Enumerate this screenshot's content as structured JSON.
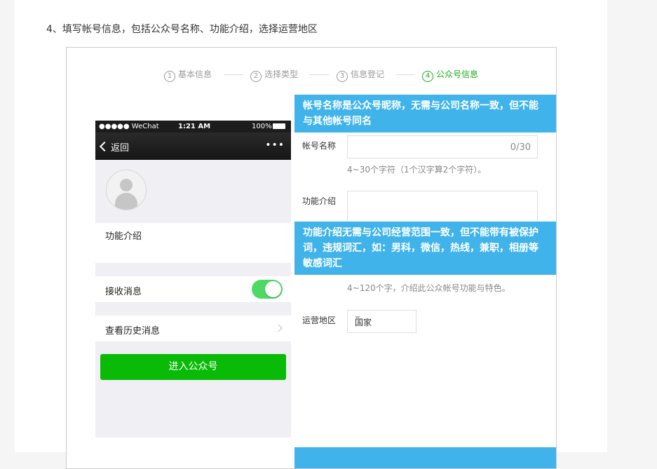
{
  "heading": "4、填写帐号信息，包括公众号名称、功能介绍，选择运营地区",
  "steps": [
    {
      "num": "1",
      "label": "基本信息",
      "active": false
    },
    {
      "num": "2",
      "label": "选择类型",
      "active": false
    },
    {
      "num": "3",
      "label": "信息登记",
      "active": false
    },
    {
      "num": "4",
      "label": "公众号信息",
      "active": true
    }
  ],
  "phone": {
    "carrier": "●●●●● WeChat",
    "time": "1:21 AM",
    "battery": "100%",
    "back_label": "返回",
    "more_label": "•••",
    "intro_label": "功能介绍",
    "receive_label": "接收消息",
    "receive_on": true,
    "history_label": "查看历史消息",
    "enter_label": "进入公众号",
    "colors": {
      "toggle": "#4cd964",
      "enter": "#09bb07"
    }
  },
  "callouts": {
    "name": "帐号名称是公众号昵称，无需与公司名称一致，但不能与其他帐号同名",
    "intro": "功能介绍无需与公司经营范围一致，但不能带有被保护词，违规词汇，如：男科，微信，热线，兼职，相册等敏感词汇",
    "color": "#40b4ea"
  },
  "form": {
    "name_label": "帐号名称",
    "name_counter": "0/30",
    "name_hint": "4~30个字符（1个汉字算2个字符）。",
    "intro_label": "功能介绍",
    "intro_hint": "4~120个字，介绍此公众帐号功能与特色。",
    "region_label": "运营地区",
    "region_value": "国家"
  }
}
